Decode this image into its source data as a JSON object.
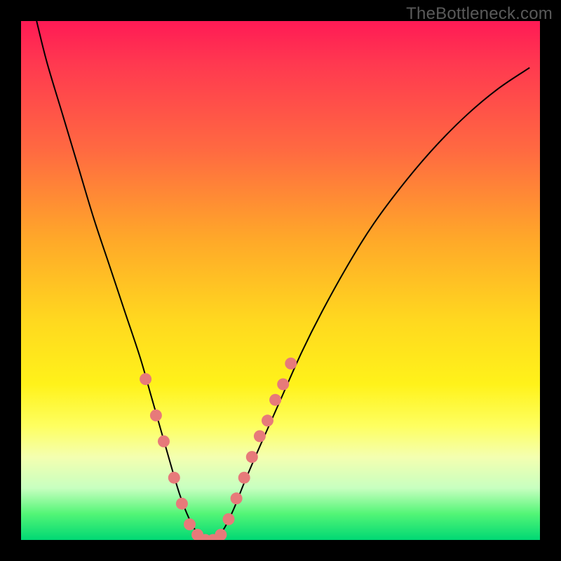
{
  "watermark": "TheBottleneck.com",
  "colors": {
    "background": "#000000",
    "curve": "#000000",
    "dot_fill": "#e77a7a",
    "dot_stroke": "#d15a5a"
  },
  "chart_data": {
    "type": "line",
    "title": "",
    "xlabel": "",
    "ylabel": "",
    "xlim": [
      0,
      100
    ],
    "ylim": [
      0,
      100
    ],
    "grid": false,
    "legend": false,
    "series": [
      {
        "name": "bottleneck-curve",
        "note": "V-shaped curve; y≈0 at trough; values estimated from pixel positions; higher = worse fit",
        "x": [
          3,
          5,
          8,
          11,
          14,
          17,
          20,
          23,
          25,
          27,
          29,
          30.5,
          32,
          33.5,
          35,
          37,
          39,
          41,
          43,
          46,
          50,
          54,
          58,
          63,
          68,
          74,
          80,
          86,
          92,
          98
        ],
        "y": [
          100,
          92,
          82,
          72,
          62,
          53,
          44,
          35,
          28,
          21,
          14,
          9,
          5,
          2,
          0,
          0,
          2,
          6,
          11,
          18,
          27,
          36,
          44,
          53,
          61,
          69,
          76,
          82,
          87,
          91
        ]
      }
    ],
    "markers": {
      "name": "highlight-dots",
      "note": "salmon dots along the lower part of the curve",
      "points": [
        {
          "x": 24.0,
          "y": 31
        },
        {
          "x": 26.0,
          "y": 24
        },
        {
          "x": 27.5,
          "y": 19
        },
        {
          "x": 29.5,
          "y": 12
        },
        {
          "x": 31.0,
          "y": 7
        },
        {
          "x": 32.5,
          "y": 3
        },
        {
          "x": 34.0,
          "y": 1
        },
        {
          "x": 35.5,
          "y": 0
        },
        {
          "x": 37.0,
          "y": 0
        },
        {
          "x": 38.5,
          "y": 1
        },
        {
          "x": 40.0,
          "y": 4
        },
        {
          "x": 41.5,
          "y": 8
        },
        {
          "x": 43.0,
          "y": 12
        },
        {
          "x": 44.5,
          "y": 16
        },
        {
          "x": 46.0,
          "y": 20
        },
        {
          "x": 47.5,
          "y": 23
        },
        {
          "x": 49.0,
          "y": 27
        },
        {
          "x": 50.5,
          "y": 30
        },
        {
          "x": 52.0,
          "y": 34
        }
      ]
    }
  }
}
